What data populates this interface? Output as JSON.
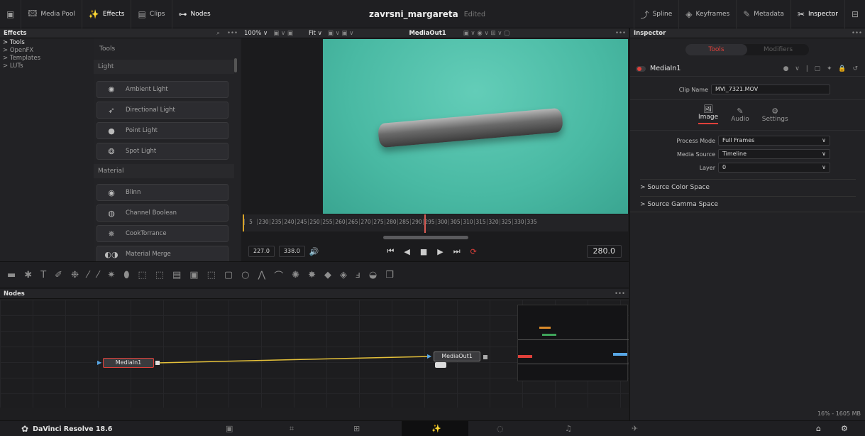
{
  "topbar": {
    "left_buttons": [
      {
        "icon": "panel-toggle-icon",
        "label": ""
      },
      {
        "icon": "media-pool-icon",
        "label": "Media Pool"
      },
      {
        "icon": "effects-icon",
        "label": "Effects",
        "active": true
      },
      {
        "icon": "clips-icon",
        "label": "Clips"
      },
      {
        "icon": "nodes-icon",
        "label": "Nodes",
        "active": true
      }
    ],
    "project_name": "zavrsni_margareta",
    "project_status": "Edited",
    "right_buttons": [
      {
        "icon": "spline-icon",
        "label": "Spline"
      },
      {
        "icon": "keyframes-icon",
        "label": "Keyframes"
      },
      {
        "icon": "metadata-icon",
        "label": "Metadata"
      },
      {
        "icon": "inspector-icon",
        "label": "Inspector",
        "active": true
      },
      {
        "icon": "fullscreen-icon",
        "label": ""
      }
    ]
  },
  "effects_panel": {
    "title": "Effects",
    "tree": [
      "Tools",
      "OpenFX",
      "Templates",
      "LUTs"
    ],
    "list_header": "Tools",
    "sections": [
      {
        "name": "Light",
        "items": [
          "Ambient Light",
          "Directional Light",
          "Point Light",
          "Spot Light"
        ]
      },
      {
        "name": "Material",
        "items": [
          "Blinn",
          "Channel Boolean",
          "CookTorrance",
          "Material Merge"
        ]
      }
    ]
  },
  "viewer": {
    "zoom": "100%",
    "fit": "Fit",
    "output_name": "MediaOut1",
    "timeline_ticks": [
      "5",
      "230",
      "235",
      "240",
      "245",
      "250",
      "255",
      "260",
      "265",
      "270",
      "275",
      "280",
      "285",
      "290",
      "295",
      "300",
      "305",
      "310",
      "315",
      "320",
      "325",
      "330",
      "335"
    ],
    "in_point": "227.0",
    "out_point": "338.0",
    "current_frame": "280.0",
    "playhead_fraction": 0.5
  },
  "inspector": {
    "title": "Inspector",
    "tab_tools": "Tools",
    "tab_modifiers": "Modifiers",
    "node_name": "MediaIn1",
    "clip_name_label": "Clip Name",
    "clip_name_value": "MVI_7321.MOV",
    "subtabs": [
      "Image",
      "Audio",
      "Settings"
    ],
    "process_mode_label": "Process Mode",
    "process_mode_value": "Full Frames",
    "media_source_label": "Media Source",
    "media_source_value": "Timeline",
    "layer_label": "Layer",
    "layer_value": "0",
    "collapsible": [
      "Source Color Space",
      "Source Gamma Space"
    ]
  },
  "nodes_panel": {
    "title": "Nodes",
    "media_in": "MediaIn1",
    "media_out": "MediaOut1"
  },
  "status": {
    "memory": "16% - 1605 MB"
  },
  "bottombar": {
    "app_name": "DaVinci Resolve 18.6"
  },
  "colors": {
    "accent_red": "#e0403a",
    "playhead": "#d85b54",
    "screen_green": "#4fbfa9",
    "link": "#e5c13a"
  }
}
